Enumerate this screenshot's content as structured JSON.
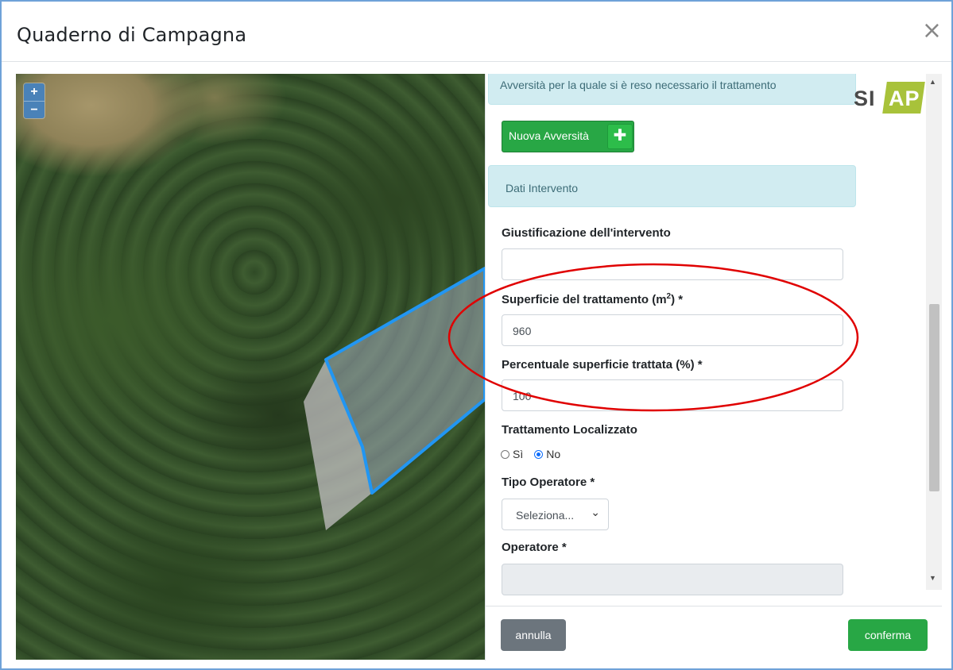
{
  "modal": {
    "title": "Quaderno di Campagna",
    "close_glyph": "×"
  },
  "map": {
    "zoom_in": "+",
    "zoom_out": "−"
  },
  "logo": {
    "part1": "SI",
    "part2": "AP"
  },
  "form": {
    "avversita_header": "Avversità per la quale si è reso necessario il trattamento",
    "nuova_avversita_label": "Nuova Avversità",
    "plus_glyph": "✚",
    "dati_intervento_header": "Dati Intervento",
    "giustificazione_label": "Giustificazione dell'intervento",
    "giustificazione_value": "",
    "superficie_label_pre": "Superficie del trattamento (m",
    "superficie_label_sup": "2",
    "superficie_label_post": ") *",
    "superficie_value": "960",
    "percentuale_label": "Percentuale superficie trattata (%) *",
    "percentuale_value": "100",
    "trattamento_localizzato_label": "Trattamento Localizzato",
    "radio_si": "Sì",
    "radio_no": "No",
    "radio_selected": "No",
    "tipo_operatore_label": "Tipo Operatore *",
    "tipo_operatore_value": "Seleziona...",
    "operatore_label": "Operatore *",
    "operatore_value": ""
  },
  "footer": {
    "annulla_label": "annulla",
    "conferma_label": "conferma"
  },
  "colors": {
    "primary_green": "#28a745",
    "secondary_gray": "#6c757d",
    "info_bg": "#d1ecf1",
    "polygon_stroke": "#2196f3",
    "highlight_ellipse": "#e00000",
    "modal_border": "#6fa2d8"
  }
}
